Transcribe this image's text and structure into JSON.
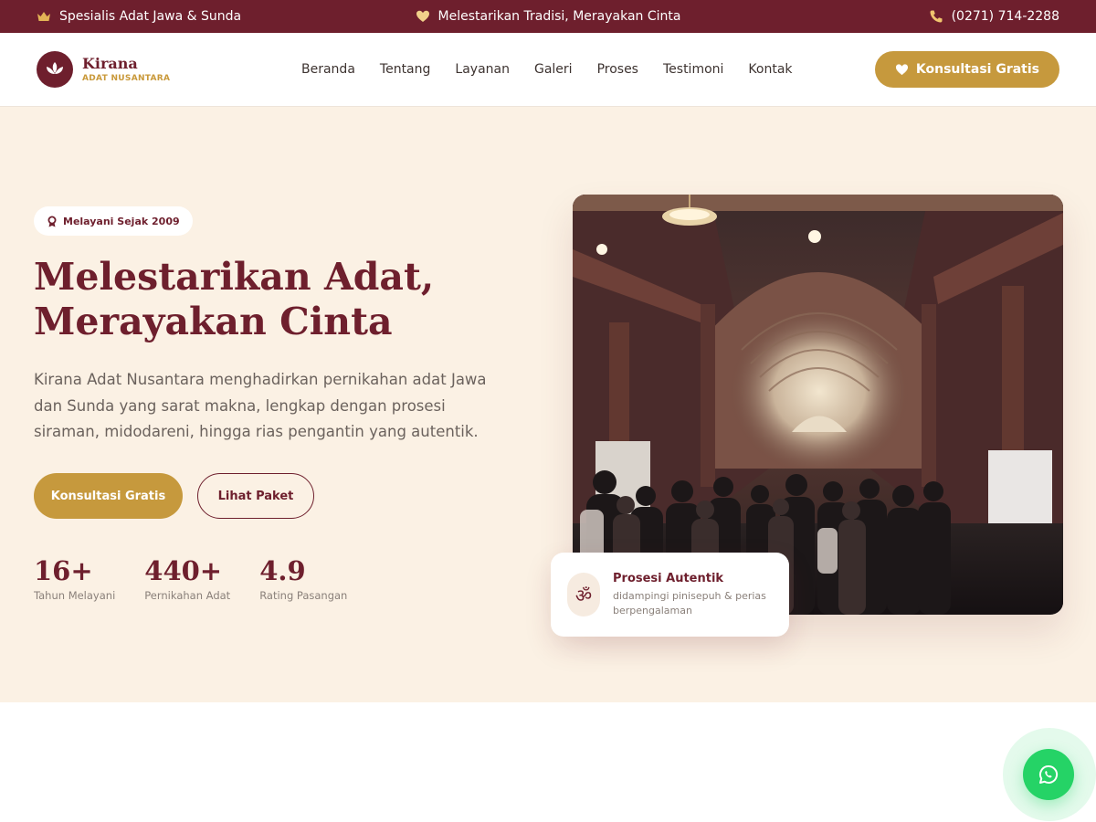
{
  "topbar": {
    "left_text": "Spesialis Adat Jawa & Sunda",
    "left_icon": "crown-icon",
    "center_text": "Melestarikan Tradisi, Merayakan Cinta",
    "center_icon": "heart-icon",
    "right_text": "(0271) 714-2288",
    "right_icon": "phone-icon"
  },
  "brand": {
    "name": "Kirana",
    "tagline": "ADAT NUSANTARA",
    "logo_icon": "lotus-icon"
  },
  "nav": {
    "items": [
      "Beranda",
      "Tentang",
      "Layanan",
      "Galeri",
      "Proses",
      "Testimoni",
      "Kontak"
    ]
  },
  "header_cta": {
    "label": "Konsultasi Gratis",
    "icon": "heart-icon"
  },
  "hero": {
    "badge": "Melayani Sejak 2009",
    "badge_icon": "award-icon",
    "title_line1": "Melestarikan Adat,",
    "title_line2": "Merayakan Cinta",
    "description": "Kirana Adat Nusantara menghadirkan pernikahan adat Jawa dan Sunda yang sarat makna, lengkap dengan prosesi siraman, midodareni, hingga rias pengantin yang autentik.",
    "primary_button": "Konsultasi Gratis",
    "secondary_button": "Lihat Paket",
    "stats": [
      {
        "value": "16+",
        "label": "Tahun Melayani"
      },
      {
        "value": "440+",
        "label": "Pernikahan Adat"
      },
      {
        "value": "4.9",
        "label": "Rating Pasangan"
      }
    ],
    "image_subject": "grand hall with arched ceiling and crowd",
    "card": {
      "icon": "om-icon",
      "symbol": "ॐ",
      "title": "Prosesi Autentik",
      "subtitle": "didampingi pinisepuh & perias berpengalaman"
    }
  },
  "whatsapp": {
    "icon": "whatsapp-icon"
  },
  "colors": {
    "primary": "#6e1f2d",
    "accent": "#c6993d",
    "hero_bg": "#fbf1e4",
    "whatsapp": "#25d366"
  }
}
